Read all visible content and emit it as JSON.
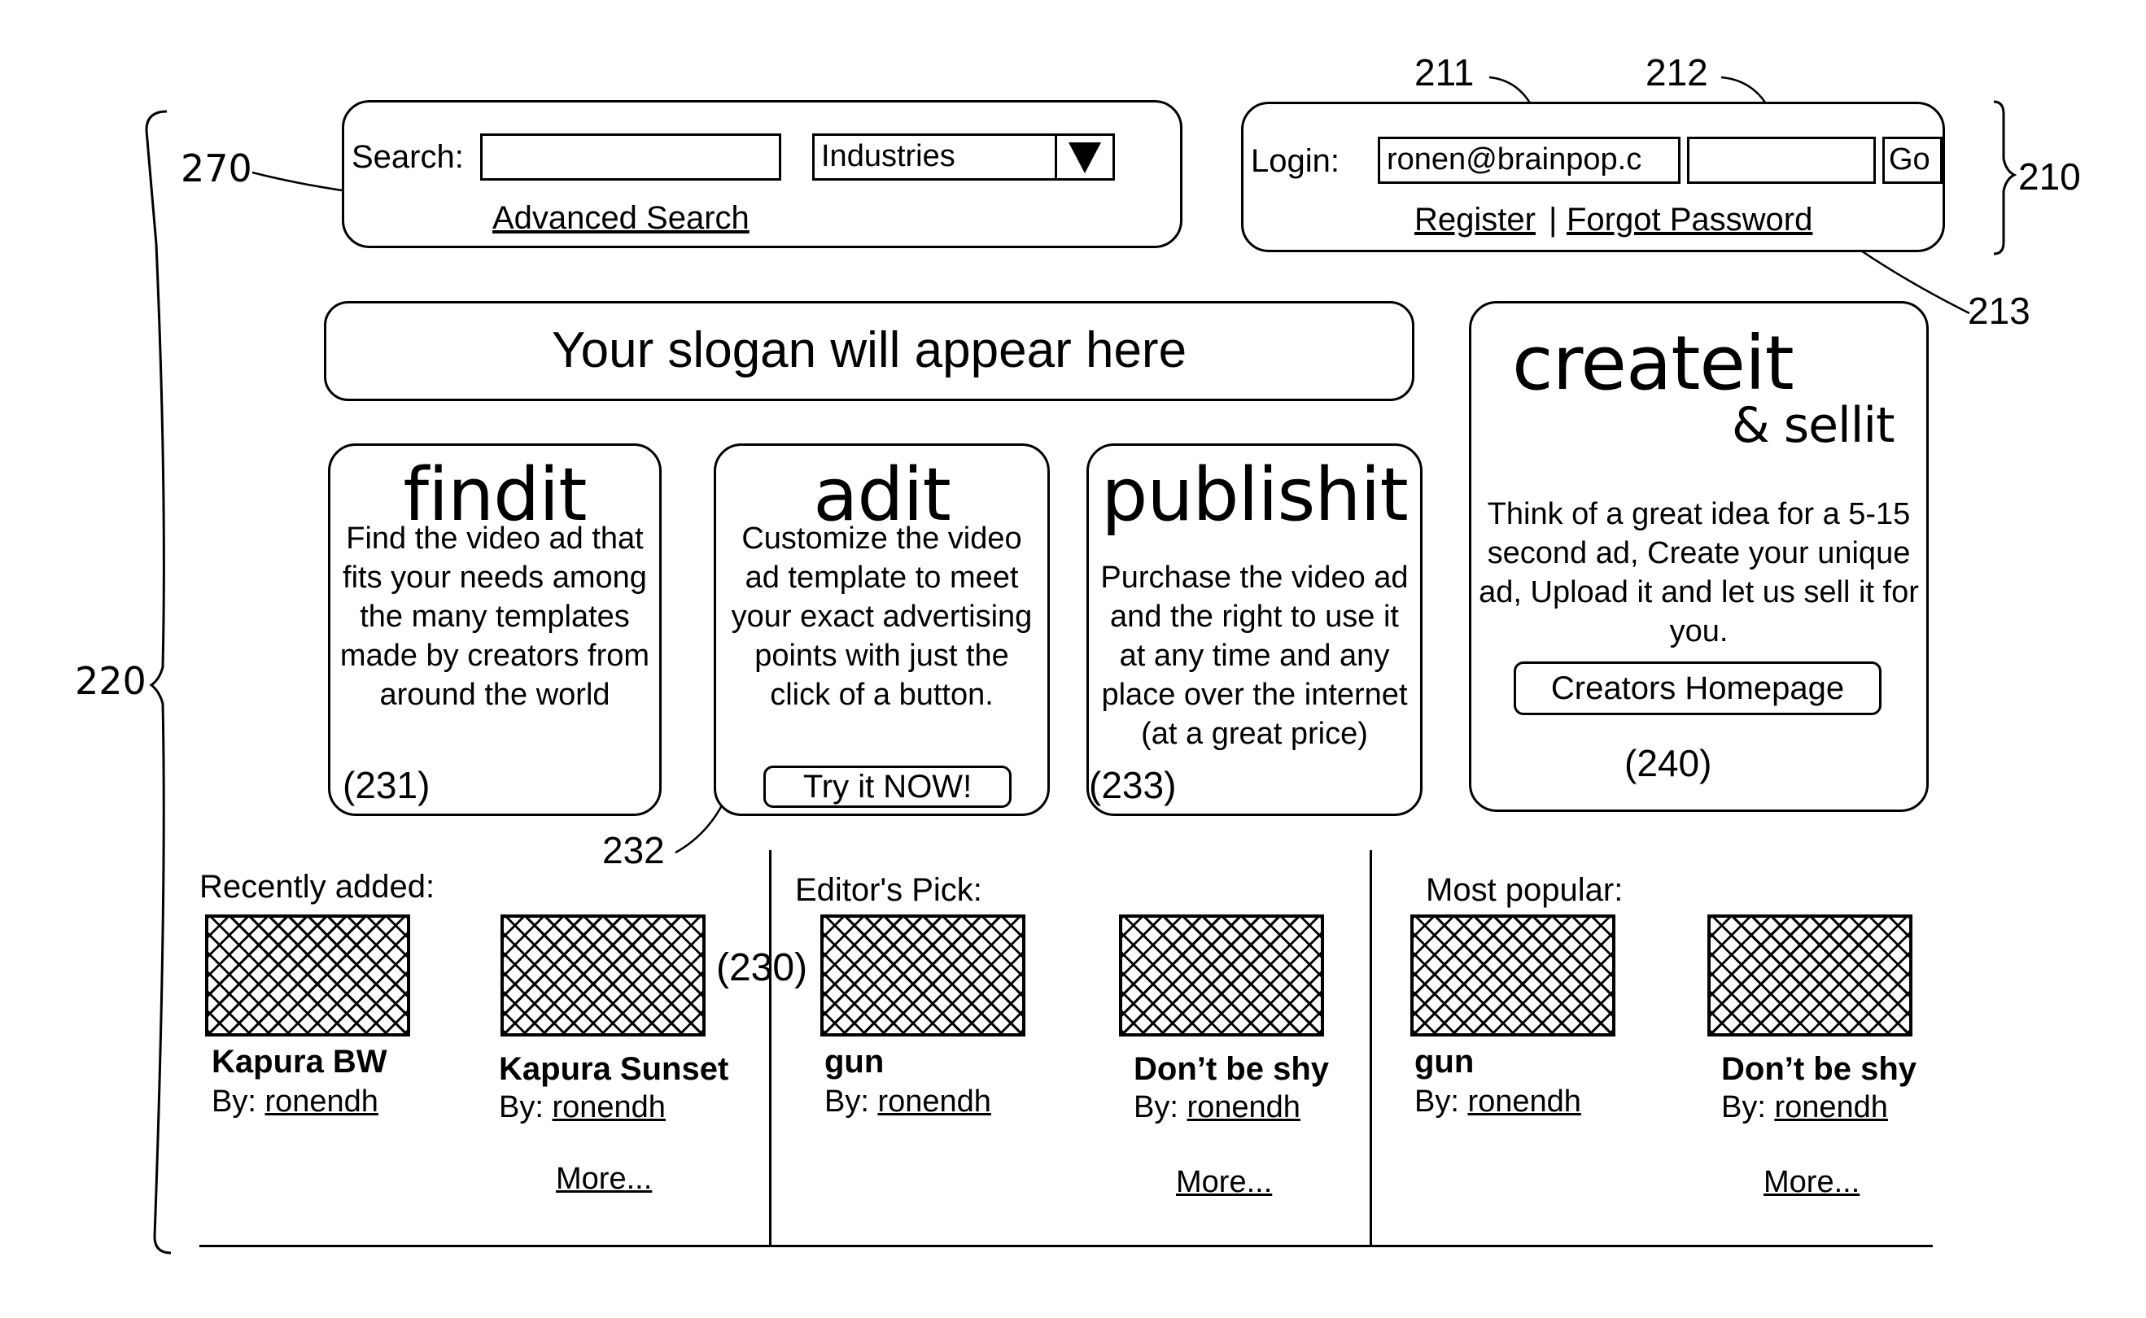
{
  "search": {
    "label": "Search:",
    "input_value": "",
    "category_selected": "Industries",
    "advanced_link": "Advanced Search"
  },
  "login": {
    "label": "Login:",
    "username_value": "ronen@brainpop.c",
    "password_value": "",
    "go_label": "Go",
    "register_link": "Register",
    "separator": "|",
    "forgot_link": "Forgot Password"
  },
  "slogan": "Your slogan will appear here",
  "features": [
    {
      "title": "findit",
      "description": "Find the video ad that fits your needs among the many templates made by creators from around the world",
      "ref": "(231)"
    },
    {
      "title": "adit",
      "description": "Customize the video ad template to meet your exact advertising points with just the  click of a button.",
      "button": "Try it NOW!"
    },
    {
      "title": "publishit",
      "description": "Purchase the video ad and the right to use it at any time and any place over the internet (at a great price)",
      "ref": "(233)"
    }
  ],
  "createit": {
    "title": "createit",
    "subtitle": "& sellit",
    "description": "Think of a great idea for a 5-15 second ad, Create your unique ad, Upload it and let us sell it for you.",
    "button": "Creators Homepage",
    "ref": "(240)"
  },
  "galleries": [
    {
      "heading": "Recently added:",
      "items": [
        {
          "title": "Kapura BW",
          "by_label": "By:",
          "author": "ronendh"
        },
        {
          "title": "Kapura Sunset",
          "by_label": "By:",
          "author": "ronendh"
        }
      ],
      "more": "More..."
    },
    {
      "heading": "Editor's Pick:",
      "items": [
        {
          "title": "gun",
          "by_label": "By:",
          "author": "ronendh"
        },
        {
          "title": "Don’t be shy",
          "by_label": "By:",
          "author": "ronendh"
        }
      ],
      "more": "More..."
    },
    {
      "heading": "Most popular:",
      "items": [
        {
          "title": "gun",
          "by_label": "By:",
          "author": "ronendh"
        },
        {
          "title": "Don’t be shy",
          "by_label": "By:",
          "author": "ronendh"
        }
      ],
      "more": "More..."
    }
  ],
  "gallery_ref": "(230)",
  "reference_labels": {
    "r210": "210",
    "r211": "211",
    "r212": "212",
    "r213": "213",
    "r220": "220",
    "r232": "232",
    "r270": "270"
  }
}
